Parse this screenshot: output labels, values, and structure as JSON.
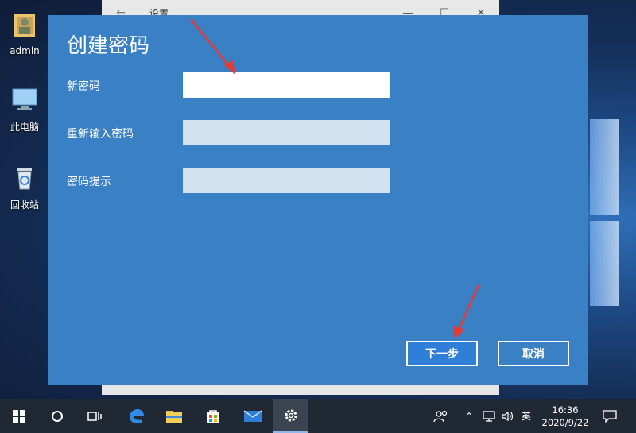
{
  "desktop": {
    "icons": [
      {
        "label": "admin",
        "icon": "user-folder-icon"
      },
      {
        "label": "此电脑",
        "icon": "computer-icon"
      },
      {
        "label": "回收站",
        "icon": "recycle-bin-icon"
      }
    ]
  },
  "settings_window": {
    "title": "设置",
    "back": "←",
    "minimize": "—",
    "maximize": "☐",
    "close": "✕"
  },
  "dialog": {
    "title": "创建密码",
    "fields": [
      {
        "label": "新密码",
        "value": "",
        "focused": true
      },
      {
        "label": "重新输入密码",
        "value": "",
        "focused": false
      },
      {
        "label": "密码提示",
        "value": "",
        "focused": false
      }
    ],
    "next_button": "下一步",
    "cancel_button": "取消"
  },
  "colors": {
    "dialog_bg": "#3a80c4",
    "input_bg": "#d2e2f1",
    "input_active_bg": "#ffffff",
    "arrow": "#e53935",
    "taskbar_bg": "#202833"
  },
  "taskbar": {
    "apps": [
      "start-icon",
      "search-circle-icon",
      "task-view-icon",
      "edge-icon",
      "file-explorer-icon",
      "store-icon",
      "mail-icon",
      "settings-gear-icon"
    ],
    "tray": {
      "ime": "英",
      "time": "16:36",
      "date": "2020/9/22"
    }
  }
}
